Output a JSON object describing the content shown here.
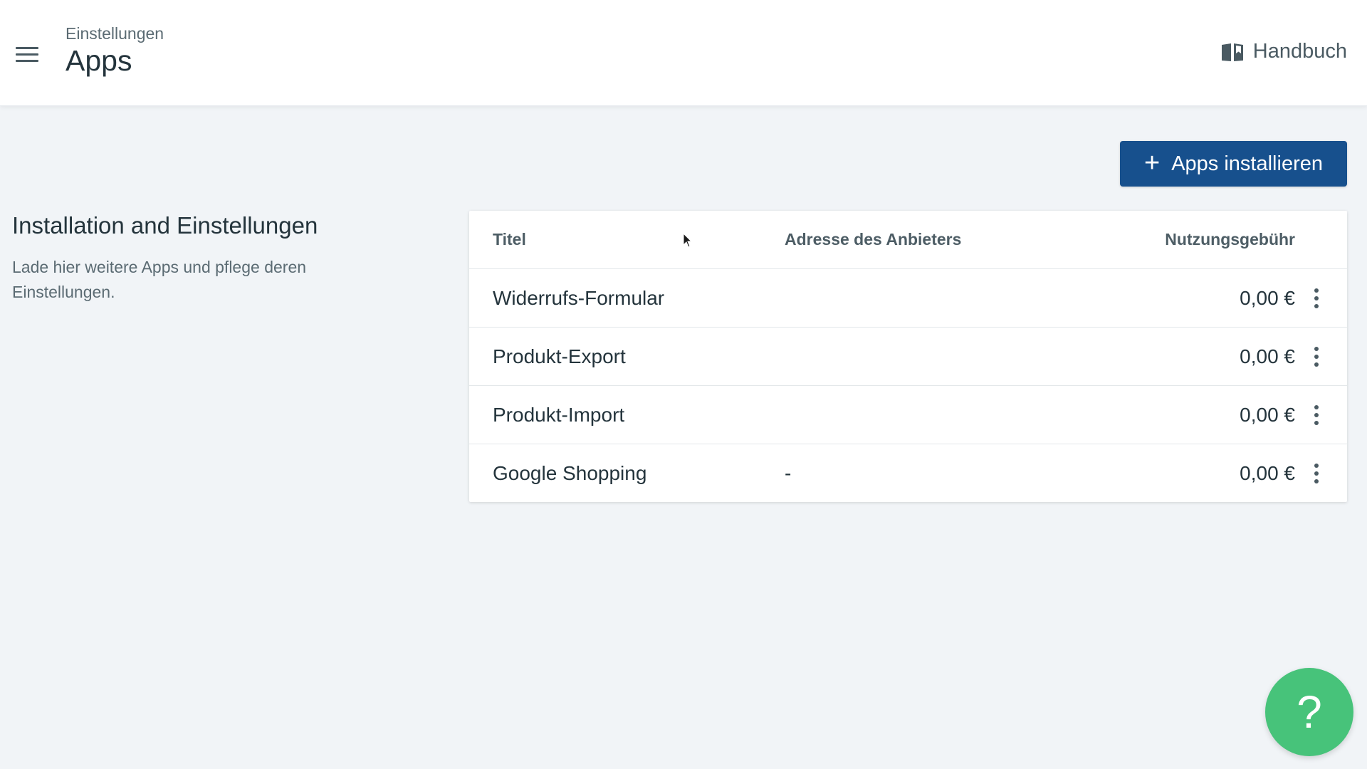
{
  "header": {
    "breadcrumb": "Einstellungen",
    "title": "Apps",
    "handbook_label": "Handbuch",
    "menu_icon": "hamburger-menu-icon",
    "handbook_icon": "book-icon"
  },
  "actions": {
    "install_label": "Apps installieren",
    "install_icon": "plus-icon",
    "install_color": "#17508d"
  },
  "section": {
    "title": "Installation and Einstellungen",
    "description": "Lade hier weitere Apps und pflege deren Einstellungen."
  },
  "table": {
    "columns": [
      "Titel",
      "Adresse des Anbieters",
      "Nutzungsgebühr"
    ],
    "rows": [
      {
        "title": "Widerrufs-Formular",
        "address": "",
        "fee": "0,00 €"
      },
      {
        "title": "Produkt-Export",
        "address": "",
        "fee": "0,00 €"
      },
      {
        "title": "Produkt-Import",
        "address": "",
        "fee": "0,00 €"
      },
      {
        "title": "Google Shopping",
        "address": "-",
        "fee": "0,00 €"
      }
    ],
    "row_menu_icon": "more-vertical-icon"
  },
  "help": {
    "label": "?",
    "color": "#47c37a"
  }
}
